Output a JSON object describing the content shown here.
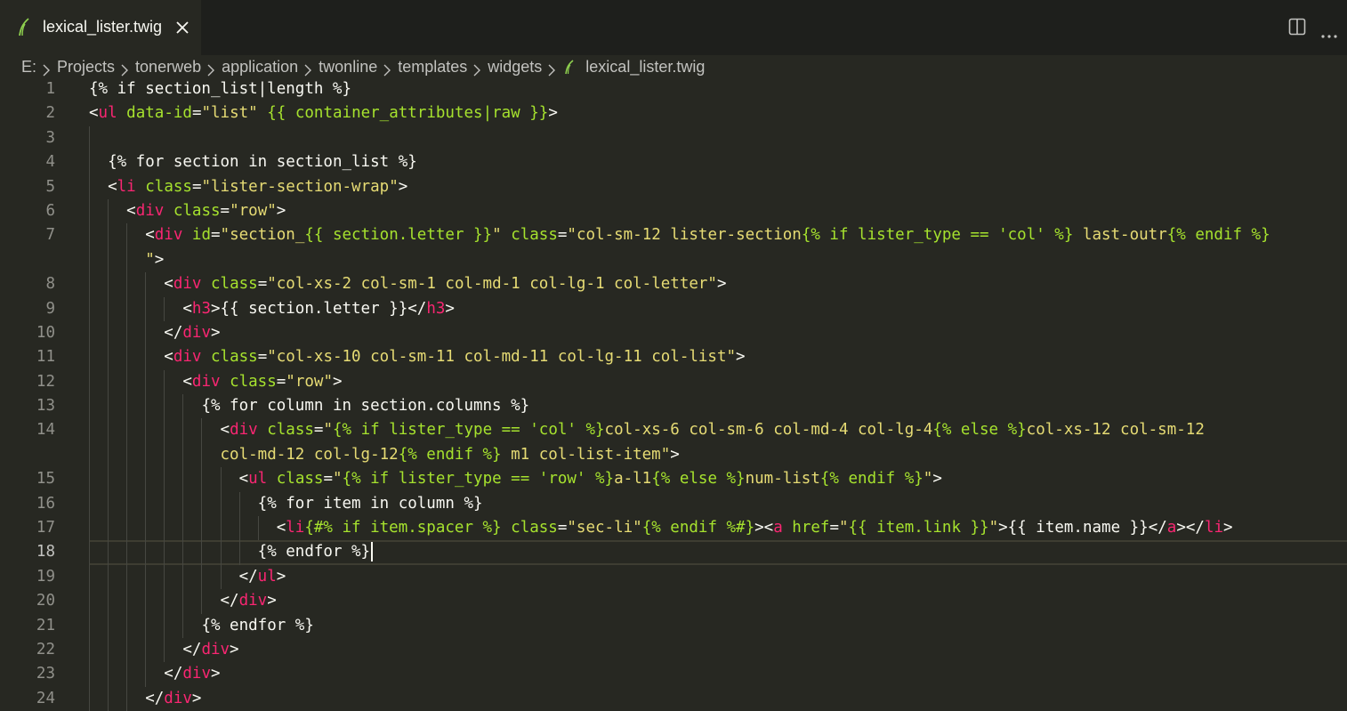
{
  "tab": {
    "label": "lexical_lister.twig",
    "close_label": "×"
  },
  "actions": {
    "split_icon": "split-editor-icon",
    "more_icon": "more-actions-icon"
  },
  "breadcrumb": [
    "E:",
    "Projects",
    "tonerweb",
    "application",
    "twonline",
    "templates",
    "widgets",
    "lexical_lister.twig"
  ],
  "editor": {
    "cursor_line": 18,
    "lines": [
      {
        "n": "1",
        "indent": 0,
        "wrap": false,
        "parts": [
          [
            "x",
            "{% if section_list|length %}"
          ]
        ]
      },
      {
        "n": "2",
        "indent": 0,
        "wrap": false,
        "parts": [
          [
            "x",
            "<"
          ],
          [
            "t",
            "ul"
          ],
          [
            "x",
            " "
          ],
          [
            "a",
            "data-id"
          ],
          [
            "x",
            "="
          ],
          [
            "s",
            "\"list\""
          ],
          [
            "x",
            " "
          ],
          [
            "a",
            "{{ container_attributes|raw }}"
          ],
          [
            "x",
            ">"
          ]
        ]
      },
      {
        "n": "3",
        "indent": 1,
        "wrap": false,
        "parts": [
          [
            "x",
            ""
          ]
        ]
      },
      {
        "n": "4",
        "indent": 1,
        "wrap": false,
        "parts": [
          [
            "x",
            "  {% for section in section_list %}"
          ]
        ]
      },
      {
        "n": "5",
        "indent": 1,
        "wrap": false,
        "parts": [
          [
            "x",
            "  <"
          ],
          [
            "t",
            "li"
          ],
          [
            "x",
            " "
          ],
          [
            "a",
            "class"
          ],
          [
            "x",
            "="
          ],
          [
            "s",
            "\"lister-section-wrap\""
          ],
          [
            "x",
            ">"
          ]
        ]
      },
      {
        "n": "6",
        "indent": 2,
        "wrap": false,
        "parts": [
          [
            "x",
            "    <"
          ],
          [
            "t",
            "div"
          ],
          [
            "x",
            " "
          ],
          [
            "a",
            "class"
          ],
          [
            "x",
            "="
          ],
          [
            "s",
            "\"row\""
          ],
          [
            "x",
            ">"
          ]
        ]
      },
      {
        "n": "7",
        "indent": 3,
        "wrap": true,
        "parts": [
          [
            "x",
            "      <"
          ],
          [
            "t",
            "div"
          ],
          [
            "x",
            " "
          ],
          [
            "a",
            "id"
          ],
          [
            "x",
            "="
          ],
          [
            "s",
            "\"section_"
          ],
          [
            "a",
            "{{ section.letter }}"
          ],
          [
            "s",
            "\""
          ],
          [
            "x",
            " "
          ],
          [
            "a",
            "class"
          ],
          [
            "x",
            "="
          ],
          [
            "s",
            "\"col-sm-12 lister-section"
          ],
          [
            "a",
            "{% if lister_type == 'col' %}"
          ],
          [
            "s",
            " last-outr"
          ],
          [
            "a",
            "{% endif %}"
          ],
          [
            "s",
            "\n      \""
          ],
          [
            "x",
            ">"
          ]
        ]
      },
      {
        "n": "8",
        "indent": 4,
        "wrap": false,
        "parts": [
          [
            "x",
            "        <"
          ],
          [
            "t",
            "div"
          ],
          [
            "x",
            " "
          ],
          [
            "a",
            "class"
          ],
          [
            "x",
            "="
          ],
          [
            "s",
            "\"col-xs-2 col-sm-1 col-md-1 col-lg-1 col-letter\""
          ],
          [
            "x",
            ">"
          ]
        ]
      },
      {
        "n": "9",
        "indent": 5,
        "wrap": false,
        "parts": [
          [
            "x",
            "          <"
          ],
          [
            "t",
            "h3"
          ],
          [
            "x",
            ">{{ section.letter }}</"
          ],
          [
            "t",
            "h3"
          ],
          [
            "x",
            ">"
          ]
        ]
      },
      {
        "n": "10",
        "indent": 4,
        "wrap": false,
        "parts": [
          [
            "x",
            "        </"
          ],
          [
            "t",
            "div"
          ],
          [
            "x",
            ">"
          ]
        ]
      },
      {
        "n": "11",
        "indent": 4,
        "wrap": false,
        "parts": [
          [
            "x",
            "        <"
          ],
          [
            "t",
            "div"
          ],
          [
            "x",
            " "
          ],
          [
            "a",
            "class"
          ],
          [
            "x",
            "="
          ],
          [
            "s",
            "\"col-xs-10 col-sm-11 col-md-11 col-lg-11 col-list\""
          ],
          [
            "x",
            ">"
          ]
        ]
      },
      {
        "n": "12",
        "indent": 5,
        "wrap": false,
        "parts": [
          [
            "x",
            "          <"
          ],
          [
            "t",
            "div"
          ],
          [
            "x",
            " "
          ],
          [
            "a",
            "class"
          ],
          [
            "x",
            "="
          ],
          [
            "s",
            "\"row\""
          ],
          [
            "x",
            ">"
          ]
        ]
      },
      {
        "n": "13",
        "indent": 6,
        "wrap": false,
        "parts": [
          [
            "x",
            "            {% for column in section.columns %}"
          ]
        ]
      },
      {
        "n": "14",
        "indent": 7,
        "wrap": true,
        "parts": [
          [
            "x",
            "              <"
          ],
          [
            "t",
            "div"
          ],
          [
            "x",
            " "
          ],
          [
            "a",
            "class"
          ],
          [
            "x",
            "="
          ],
          [
            "s",
            "\""
          ],
          [
            "a",
            "{% if lister_type == 'col' %}"
          ],
          [
            "s",
            "col-xs-6 col-sm-6 col-md-4 col-lg-4"
          ],
          [
            "a",
            "{% else %}"
          ],
          [
            "s",
            "col-xs-12 col-sm-12\n              col-md-12 col-lg-12"
          ],
          [
            "a",
            "{% endif %}"
          ],
          [
            "s",
            " m1 col-list-item\""
          ],
          [
            "x",
            ">"
          ]
        ]
      },
      {
        "n": "15",
        "indent": 8,
        "wrap": false,
        "parts": [
          [
            "x",
            "                <"
          ],
          [
            "t",
            "ul"
          ],
          [
            "x",
            " "
          ],
          [
            "a",
            "class"
          ],
          [
            "x",
            "="
          ],
          [
            "s",
            "\""
          ],
          [
            "a",
            "{% if lister_type == 'row' %}"
          ],
          [
            "s",
            "a-l1"
          ],
          [
            "a",
            "{% else %}"
          ],
          [
            "s",
            "num-list"
          ],
          [
            "a",
            "{% endif %}"
          ],
          [
            "s",
            "\""
          ],
          [
            "x",
            ">"
          ]
        ]
      },
      {
        "n": "16",
        "indent": 9,
        "wrap": false,
        "parts": [
          [
            "x",
            "                  {% for item in column %}"
          ]
        ]
      },
      {
        "n": "17",
        "indent": 10,
        "wrap": false,
        "parts": [
          [
            "x",
            "                    <"
          ],
          [
            "t",
            "li"
          ],
          [
            "a",
            "{#% if item.spacer %}"
          ],
          [
            "x",
            " "
          ],
          [
            "a",
            "class"
          ],
          [
            "x",
            "="
          ],
          [
            "s",
            "\"sec-li\""
          ],
          [
            "a",
            "{% endif %#}"
          ],
          [
            "x",
            "><"
          ],
          [
            "t",
            "a"
          ],
          [
            "x",
            " "
          ],
          [
            "a",
            "href"
          ],
          [
            "x",
            "="
          ],
          [
            "s",
            "\""
          ],
          [
            "a",
            "{{ item.link }}"
          ],
          [
            "s",
            "\""
          ],
          [
            "x",
            ">{{ item.name }}</"
          ],
          [
            "t",
            "a"
          ],
          [
            "x",
            "></"
          ],
          [
            "t",
            "li"
          ],
          [
            "x",
            ">"
          ]
        ]
      },
      {
        "n": "18",
        "indent": 9,
        "wrap": false,
        "parts": [
          [
            "x",
            "                  {% endfor %}"
          ]
        ]
      },
      {
        "n": "19",
        "indent": 8,
        "wrap": false,
        "parts": [
          [
            "x",
            "                </"
          ],
          [
            "t",
            "ul"
          ],
          [
            "x",
            ">"
          ]
        ]
      },
      {
        "n": "20",
        "indent": 7,
        "wrap": false,
        "parts": [
          [
            "x",
            "              </"
          ],
          [
            "t",
            "div"
          ],
          [
            "x",
            ">"
          ]
        ]
      },
      {
        "n": "21",
        "indent": 6,
        "wrap": false,
        "parts": [
          [
            "x",
            "            {% endfor %}"
          ]
        ]
      },
      {
        "n": "22",
        "indent": 5,
        "wrap": false,
        "parts": [
          [
            "x",
            "          </"
          ],
          [
            "t",
            "div"
          ],
          [
            "x",
            ">"
          ]
        ]
      },
      {
        "n": "23",
        "indent": 4,
        "wrap": false,
        "parts": [
          [
            "x",
            "        </"
          ],
          [
            "t",
            "div"
          ],
          [
            "x",
            ">"
          ]
        ]
      },
      {
        "n": "24",
        "indent": 3,
        "wrap": false,
        "parts": [
          [
            "x",
            "      </"
          ],
          [
            "t",
            "div"
          ],
          [
            "x",
            ">"
          ]
        ]
      }
    ]
  }
}
